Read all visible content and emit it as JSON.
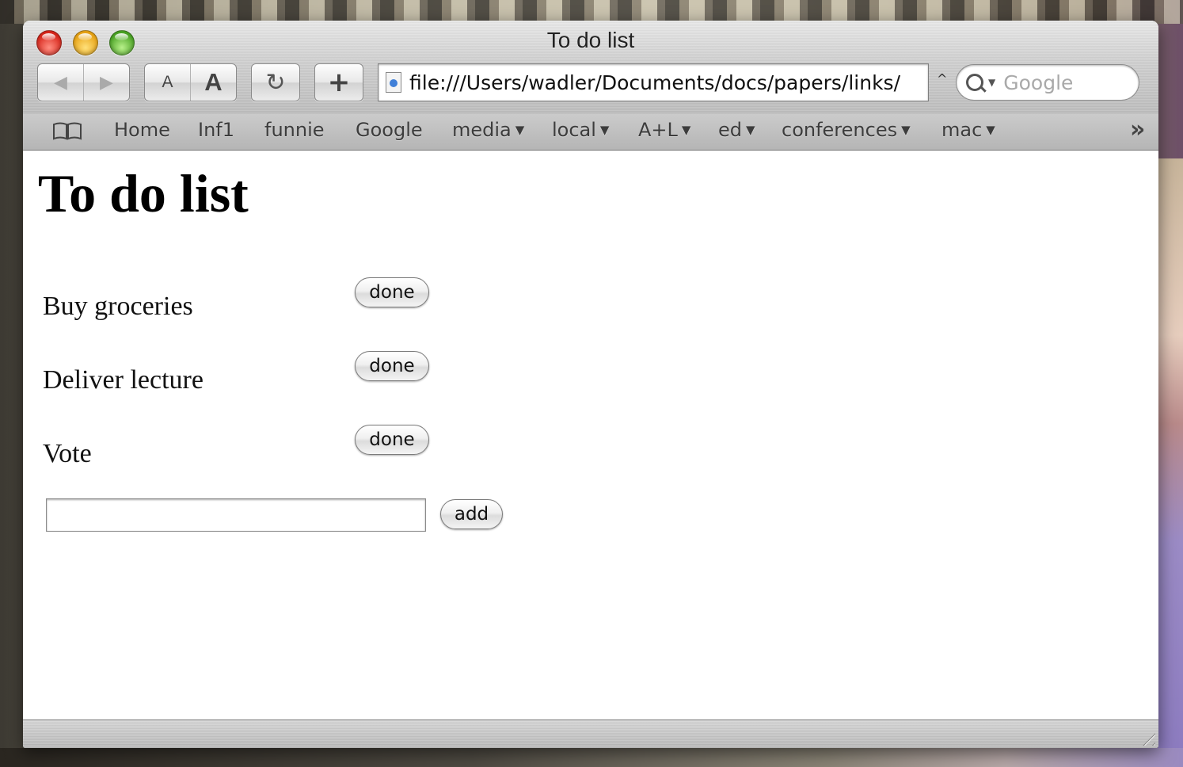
{
  "window": {
    "title": "To do list"
  },
  "toolbar": {
    "back_icon": "◀",
    "forward_icon": "▶",
    "text_smaller": "A",
    "text_bigger": "A",
    "reload_icon": "↻",
    "add_bookmark_icon": "+",
    "url": "file:///Users/wadler/Documents/docs/papers/links/",
    "search_placeholder": "Google"
  },
  "bookmarks": {
    "items": [
      {
        "label": "Home",
        "menu": false
      },
      {
        "label": "Inf1",
        "menu": false
      },
      {
        "label": "funnie",
        "menu": false
      },
      {
        "label": "Google",
        "menu": false
      },
      {
        "label": "media",
        "menu": true
      },
      {
        "label": "local",
        "menu": true
      },
      {
        "label": "A+L",
        "menu": true
      },
      {
        "label": "ed",
        "menu": true
      },
      {
        "label": "conferences",
        "menu": true
      },
      {
        "label": "mac",
        "menu": true
      }
    ],
    "menu_arrow": "▼",
    "overflow_icon": "»"
  },
  "page": {
    "heading": "To do list",
    "todos": [
      {
        "text": "Buy groceries",
        "button": "done"
      },
      {
        "text": "Deliver lecture",
        "button": "done"
      },
      {
        "text": "Vote",
        "button": "done"
      }
    ],
    "new_item_value": "",
    "add_button": "add"
  }
}
